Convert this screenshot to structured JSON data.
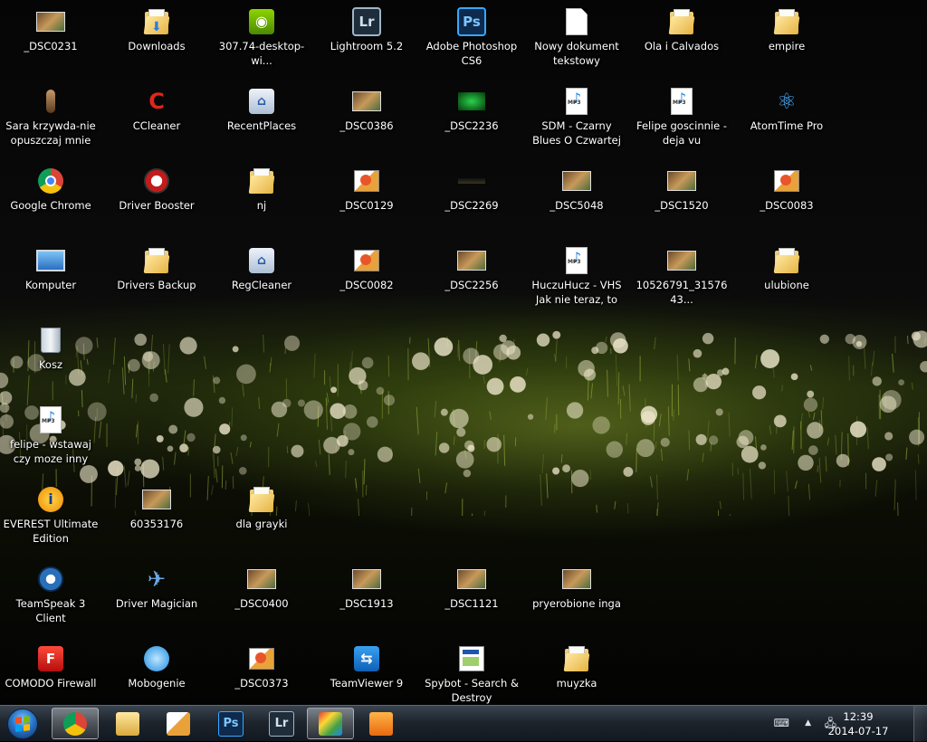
{
  "desktop": {
    "icons": [
      {
        "label": "_DSC0231",
        "icon": "photo-thumbnail-icon",
        "col": 0,
        "row": 0
      },
      {
        "label": "Downloads",
        "icon": "downloads-folder-icon",
        "col": 1,
        "row": 0
      },
      {
        "label": "307.74-desktop-wi...",
        "icon": "nvidia-installer-icon",
        "col": 2,
        "row": 0
      },
      {
        "label": "Lightroom 5.2",
        "icon": "lightroom-icon",
        "col": 3,
        "row": 0
      },
      {
        "label": "Adobe Photoshop CS6",
        "icon": "photoshop-icon",
        "col": 4,
        "row": 0
      },
      {
        "label": "Nowy dokument tekstowy",
        "icon": "text-document-icon",
        "col": 5,
        "row": 0
      },
      {
        "label": "Ola i Calvados",
        "icon": "folder-icon",
        "col": 6,
        "row": 0
      },
      {
        "label": "empire",
        "icon": "folder-icon",
        "col": 7,
        "row": 0
      },
      {
        "label": "Sara krzywda-nie opuszczaj mnie",
        "icon": "figure-icon",
        "col": 0,
        "row": 1
      },
      {
        "label": "CCleaner",
        "icon": "ccleaner-icon",
        "col": 1,
        "row": 1
      },
      {
        "label": "RecentPlaces",
        "icon": "recent-places-icon",
        "col": 2,
        "row": 1
      },
      {
        "label": "_DSC0386",
        "icon": "photo-thumbnail-icon",
        "col": 3,
        "row": 1
      },
      {
        "label": "_DSC2236",
        "icon": "green-photo-icon",
        "col": 4,
        "row": 1
      },
      {
        "label": "SDM - Czarny Blues O Czwartej Nad R...",
        "icon": "mp3-file-icon",
        "col": 5,
        "row": 1
      },
      {
        "label": "Felipe goscinnie - deja vu",
        "icon": "mp3-file-icon",
        "col": 6,
        "row": 1
      },
      {
        "label": "AtomTime Pro",
        "icon": "atom-icon",
        "col": 7,
        "row": 1
      },
      {
        "label": "Google Chrome",
        "icon": "chrome-icon",
        "col": 0,
        "row": 2
      },
      {
        "label": "Driver Booster",
        "icon": "driver-booster-icon",
        "col": 1,
        "row": 2
      },
      {
        "label": "nj",
        "icon": "folder-icon",
        "col": 2,
        "row": 2
      },
      {
        "label": "_DSC0129",
        "icon": "photo-viewer-icon",
        "col": 3,
        "row": 2
      },
      {
        "label": "_DSC2269",
        "icon": "dark-photo-icon",
        "col": 4,
        "row": 2
      },
      {
        "label": "_DSC5048",
        "icon": "photo-thumbnail-icon",
        "col": 5,
        "row": 2
      },
      {
        "label": "_DSC1520",
        "icon": "photo-thumbnail-icon",
        "col": 6,
        "row": 2
      },
      {
        "label": "_DSC0083",
        "icon": "photo-viewer-icon",
        "col": 7,
        "row": 2
      },
      {
        "label": "Komputer",
        "icon": "computer-icon",
        "col": 0,
        "row": 3
      },
      {
        "label": "Drivers Backup",
        "icon": "folder-icon",
        "col": 1,
        "row": 3
      },
      {
        "label": "RegCleaner",
        "icon": "regcleaner-icon",
        "col": 2,
        "row": 3
      },
      {
        "label": "_DSC0082",
        "icon": "photo-viewer-icon",
        "col": 3,
        "row": 3
      },
      {
        "label": "_DSC2256",
        "icon": "photo-thumbnail-icon",
        "col": 4,
        "row": 3
      },
      {
        "label": "HuczuHucz - VHS Jak nie teraz, to k...",
        "icon": "mp3-file-icon",
        "col": 5,
        "row": 3
      },
      {
        "label": "10526791_3157643...",
        "icon": "photo-thumbnail-icon",
        "col": 6,
        "row": 3
      },
      {
        "label": "ulubione",
        "icon": "folder-icon",
        "col": 7,
        "row": 3
      },
      {
        "label": "Kosz",
        "icon": "recycle-bin-icon",
        "col": 0,
        "row": 4
      },
      {
        "label": "felipe - wstawaj czy moze inny tytul [s...",
        "icon": "mp3-file-icon",
        "col": 0,
        "row": 5
      },
      {
        "label": "EVEREST Ultimate Edition",
        "icon": "everest-icon",
        "col": 0,
        "row": 6
      },
      {
        "label": "60353176",
        "icon": "photo-thumbnail-icon",
        "col": 1,
        "row": 6
      },
      {
        "label": "dla grayki",
        "icon": "folder-icon",
        "col": 2,
        "row": 6
      },
      {
        "label": "TeamSpeak 3 Client",
        "icon": "teamspeak-icon",
        "col": 0,
        "row": 7
      },
      {
        "label": "Driver Magician",
        "icon": "driver-magician-icon",
        "col": 1,
        "row": 7
      },
      {
        "label": "_DSC0400",
        "icon": "photo-thumbnail-icon",
        "col": 2,
        "row": 7
      },
      {
        "label": "_DSC1913",
        "icon": "photo-thumbnail-icon",
        "col": 3,
        "row": 7
      },
      {
        "label": "_DSC1121",
        "icon": "photo-thumbnail-icon",
        "col": 4,
        "row": 7
      },
      {
        "label": "pryerobione inga",
        "icon": "photo-thumbnail-icon",
        "col": 5,
        "row": 7
      },
      {
        "label": "COMODO Firewall",
        "icon": "comodo-icon",
        "col": 0,
        "row": 8
      },
      {
        "label": "Mobogenie",
        "icon": "mobogenie-icon",
        "col": 1,
        "row": 8
      },
      {
        "label": "_DSC0373",
        "icon": "photo-viewer-icon",
        "col": 2,
        "row": 8
      },
      {
        "label": "TeamViewer 9",
        "icon": "teamviewer-icon",
        "col": 3,
        "row": 8
      },
      {
        "label": "Spybot - Search & Destroy",
        "icon": "spybot-icon",
        "col": 4,
        "row": 8
      },
      {
        "label": "muyzka",
        "icon": "folder-icon",
        "col": 5,
        "row": 8
      }
    ]
  },
  "taskbar": {
    "pinned": [
      {
        "name": "chrome-taskbar-button",
        "icon": "chrome-icon",
        "active": true
      },
      {
        "name": "explorer-taskbar-button",
        "icon": "folder-icon",
        "active": false
      },
      {
        "name": "photo-viewer-taskbar-button",
        "icon": "photo-viewer-icon",
        "active": false
      },
      {
        "name": "photoshop-taskbar-button",
        "icon": "photoshop-icon",
        "active": false,
        "text": "Ps"
      },
      {
        "name": "lightroom-taskbar-button",
        "icon": "lightroom-icon",
        "active": false,
        "text": "Lr"
      },
      {
        "name": "app-taskbar-button",
        "icon": "colorful-app-icon",
        "active": true
      },
      {
        "name": "media-player-taskbar-button",
        "icon": "media-player-icon",
        "active": false
      }
    ],
    "clock": {
      "time": "12:39",
      "date": "2014-07-17"
    }
  },
  "colors": {
    "photoshop": "#0e2a4d",
    "lightroom": "#1f2d3a",
    "taskbar": "#1e252d"
  }
}
